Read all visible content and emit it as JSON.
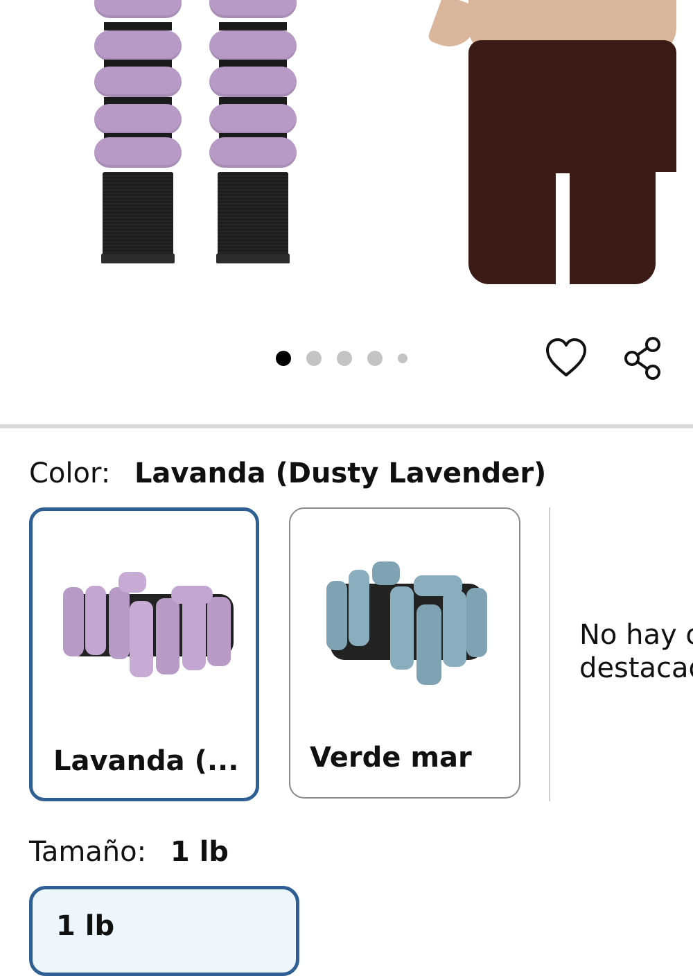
{
  "gallery": {
    "dot_count": 5,
    "active_index": 0
  },
  "actions": {
    "favorite_icon": "heart-icon",
    "share_icon": "share-icon"
  },
  "color": {
    "label": "Color:",
    "selected_value": "Lavanda (Dusty Lavender)",
    "options": [
      {
        "label": "Lavanda (...",
        "swatch_color": "#b79ac6",
        "selected": true
      },
      {
        "label": "Verde mar",
        "swatch_color": "#7fa3b3",
        "selected": false
      }
    ],
    "unavailable_text": "No hay o\ndestacad"
  },
  "size": {
    "label": "Tamaño:",
    "selected_value": "1 lb",
    "options": [
      {
        "label": "1 lb",
        "selected": true
      }
    ]
  },
  "colors": {
    "selected_border": "#2f5f93",
    "selected_fill": "#edf6fd",
    "divider": "#dadada"
  }
}
